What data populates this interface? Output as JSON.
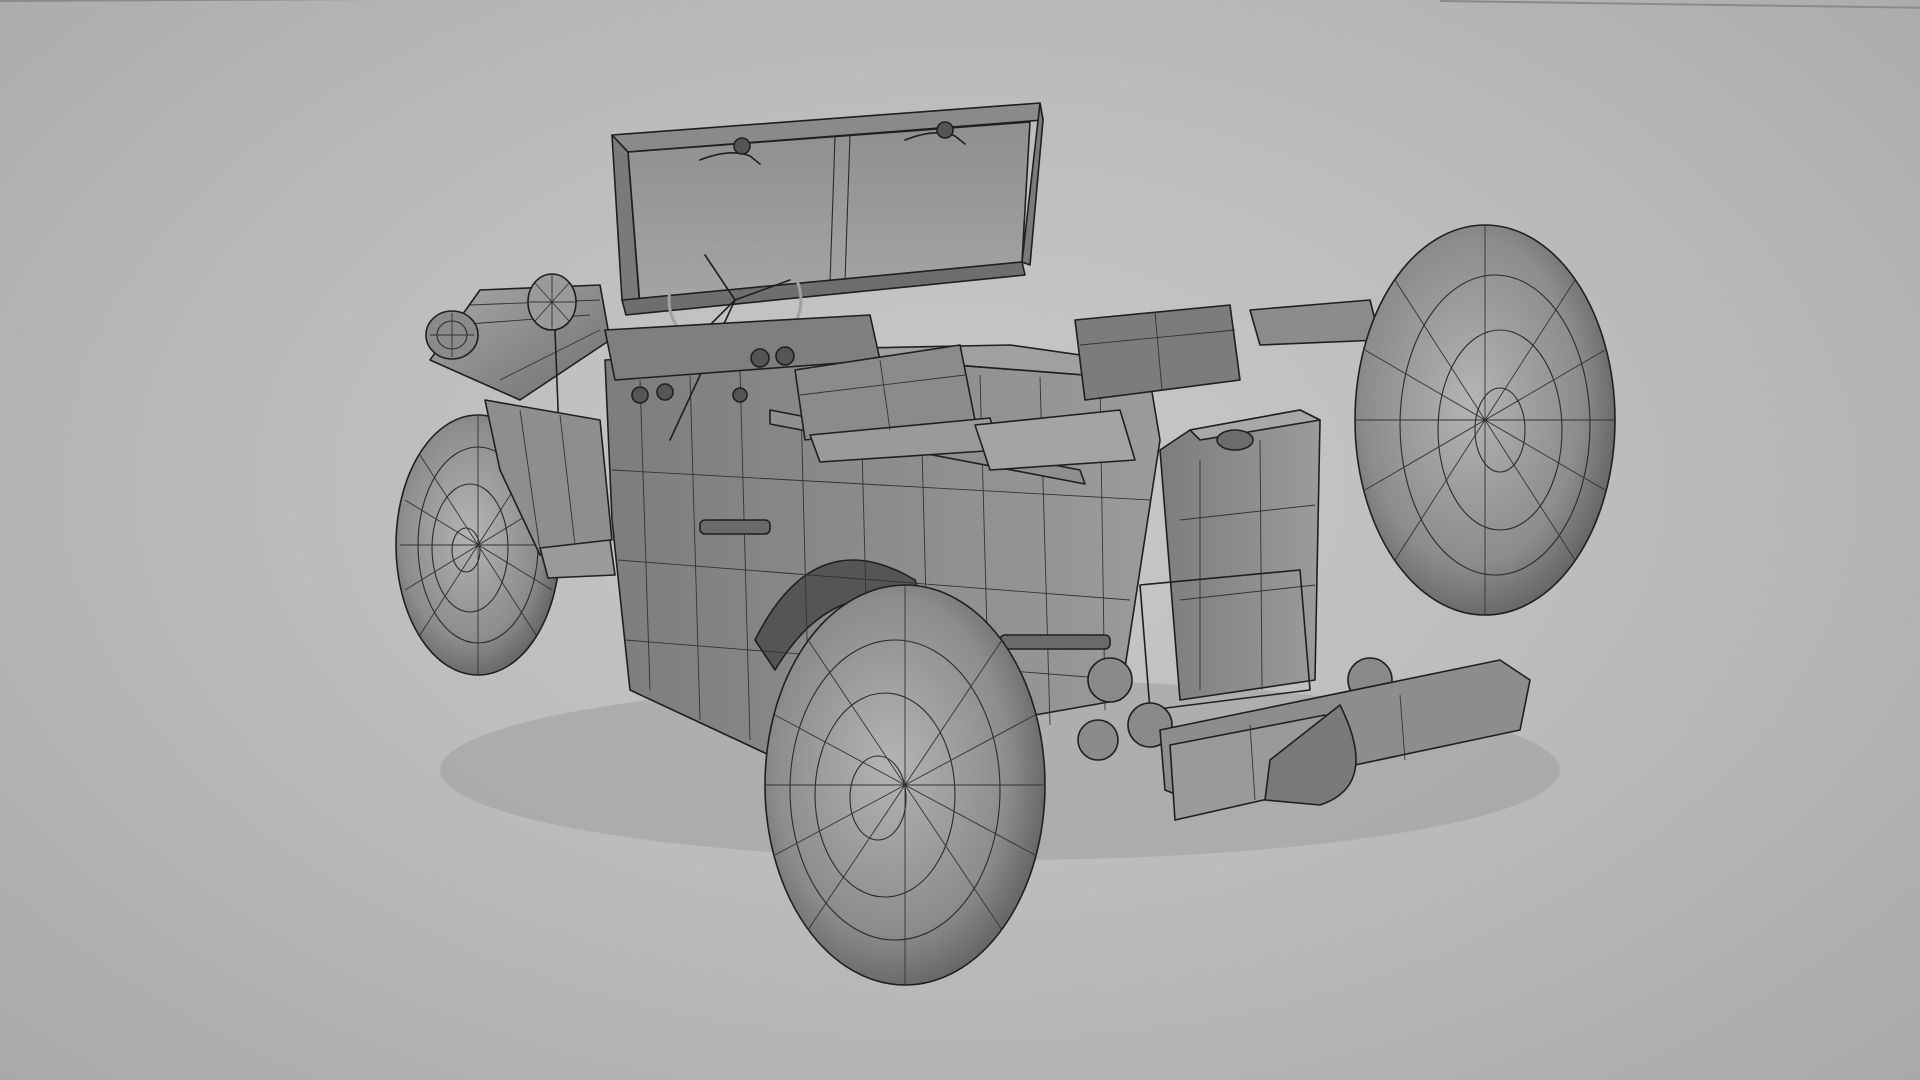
{
  "viewport": {
    "background_color": "#bdbdbd",
    "model_surface_color": "#8c8c8c",
    "wireframe_color": "#1f1f1f",
    "shading": "wireframe-on-shaded"
  },
  "model": {
    "subject": "military-jeep-3d-mesh",
    "parts": [
      "windshield",
      "steering-wheel",
      "front-seat",
      "rear-seat",
      "jerry-can",
      "spare-wheel",
      "front-wheel",
      "rear-wheel",
      "headlight",
      "mirror",
      "tail-lights",
      "bumper"
    ]
  }
}
